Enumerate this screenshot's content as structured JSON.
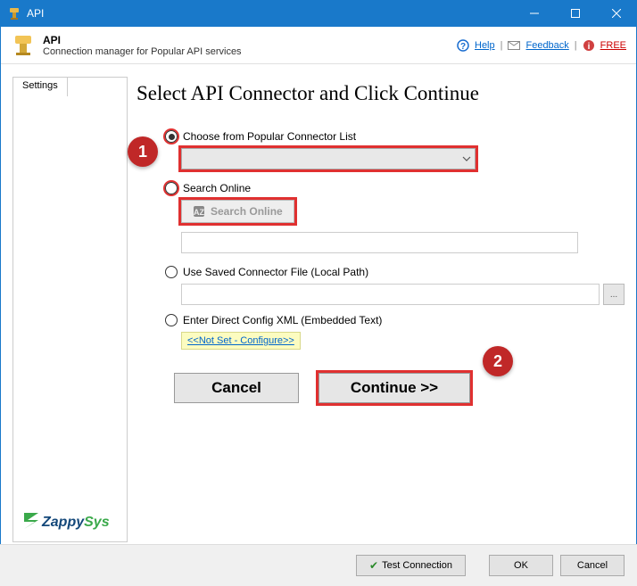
{
  "titlebar": {
    "title": "API"
  },
  "header": {
    "title": "API",
    "subtitle": "Connection manager for Popular API services",
    "links": {
      "help": "Help",
      "feedback": "Feedback",
      "free": "FREE"
    }
  },
  "sidebar": {
    "tab": "Settings",
    "logo_text": "ZappySys"
  },
  "main": {
    "heading": "Select API Connector and Click Continue",
    "opt1_label": "Choose from Popular Connector List",
    "opt2_label": "Search Online",
    "search_btn": "Search Online",
    "opt3_label": "Use Saved Connector File (Local Path)",
    "browse_label": "...",
    "opt4_label": "Enter Direct Config XML (Embedded Text)",
    "config_link": "<<Not Set - Configure>>",
    "cancel": "Cancel",
    "continue": "Continue >>"
  },
  "footer": {
    "test": "Test Connection",
    "ok": "OK",
    "cancel": "Cancel"
  },
  "steps": {
    "one": "1",
    "two": "2"
  }
}
